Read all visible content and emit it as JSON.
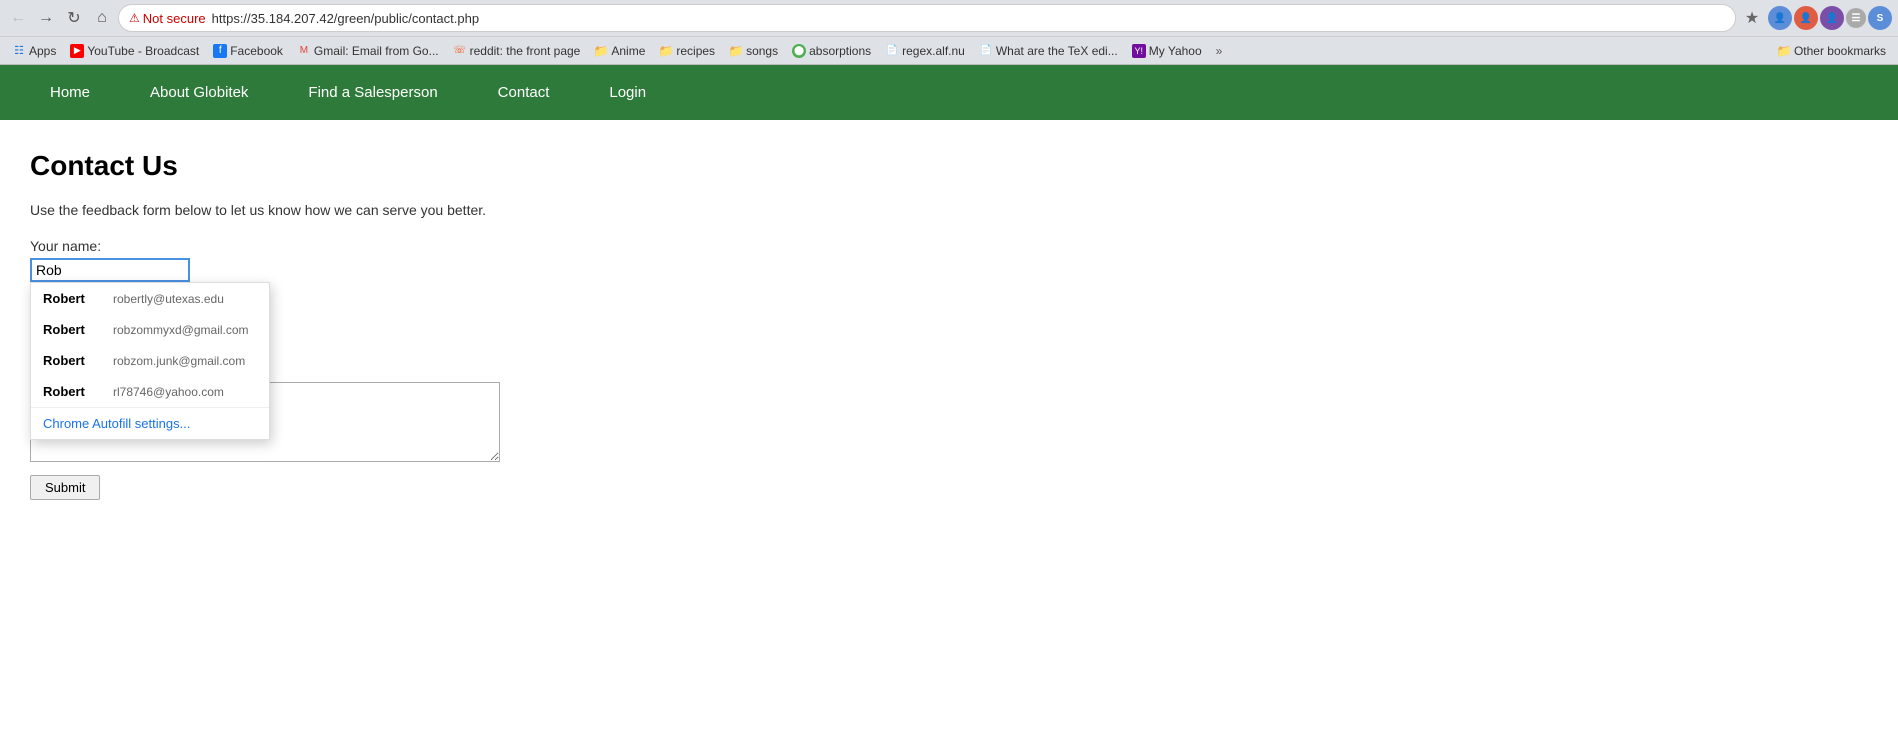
{
  "browser": {
    "url_warning": "Not secure",
    "url_full": "https://35.184.207.42/green/public/contact.php",
    "url_display": "https://35.184.207.42/green/public/contact.php"
  },
  "bookmarks": {
    "items": [
      {
        "label": "Apps",
        "type": "apps"
      },
      {
        "label": "YouTube - Broadcast",
        "type": "yt"
      },
      {
        "label": "Facebook",
        "type": "fb"
      },
      {
        "label": "Gmail: Email from Go...",
        "type": "gmail"
      },
      {
        "label": "reddit: the front page",
        "type": "reddit"
      },
      {
        "label": "Anime",
        "type": "folder"
      },
      {
        "label": "recipes",
        "type": "folder"
      },
      {
        "label": "songs",
        "type": "folder"
      },
      {
        "label": "absorptions",
        "type": "absorb"
      },
      {
        "label": "regex.alf.nu",
        "type": "regex"
      },
      {
        "label": "What are the TeX edi...",
        "type": "tex"
      },
      {
        "label": "My Yahoo",
        "type": "yahoo"
      }
    ],
    "more_label": "»",
    "other_label": "Other bookmarks"
  },
  "nav": {
    "items": [
      {
        "label": "Home"
      },
      {
        "label": "About Globitek"
      },
      {
        "label": "Find a Salesperson"
      },
      {
        "label": "Contact"
      },
      {
        "label": "Login"
      }
    ]
  },
  "page": {
    "title": "Contact Us",
    "subtitle": "Use the feedback form below to let us know how we can serve you better.",
    "form": {
      "name_label": "Your name:",
      "name_value": "Rob",
      "message_placeholder": "",
      "submit_label": "Submit"
    },
    "autofill": {
      "items": [
        {
          "first": "Robert",
          "email": "robertly@utexas.edu"
        },
        {
          "first": "Robert",
          "email": "robzommyxd@gmail.com"
        },
        {
          "first": "Robert",
          "email": "robzom.junk@gmail.com"
        },
        {
          "first": "Robert",
          "email": "rl78746@yahoo.com"
        }
      ],
      "settings_label": "Chrome Autofill settings..."
    }
  }
}
